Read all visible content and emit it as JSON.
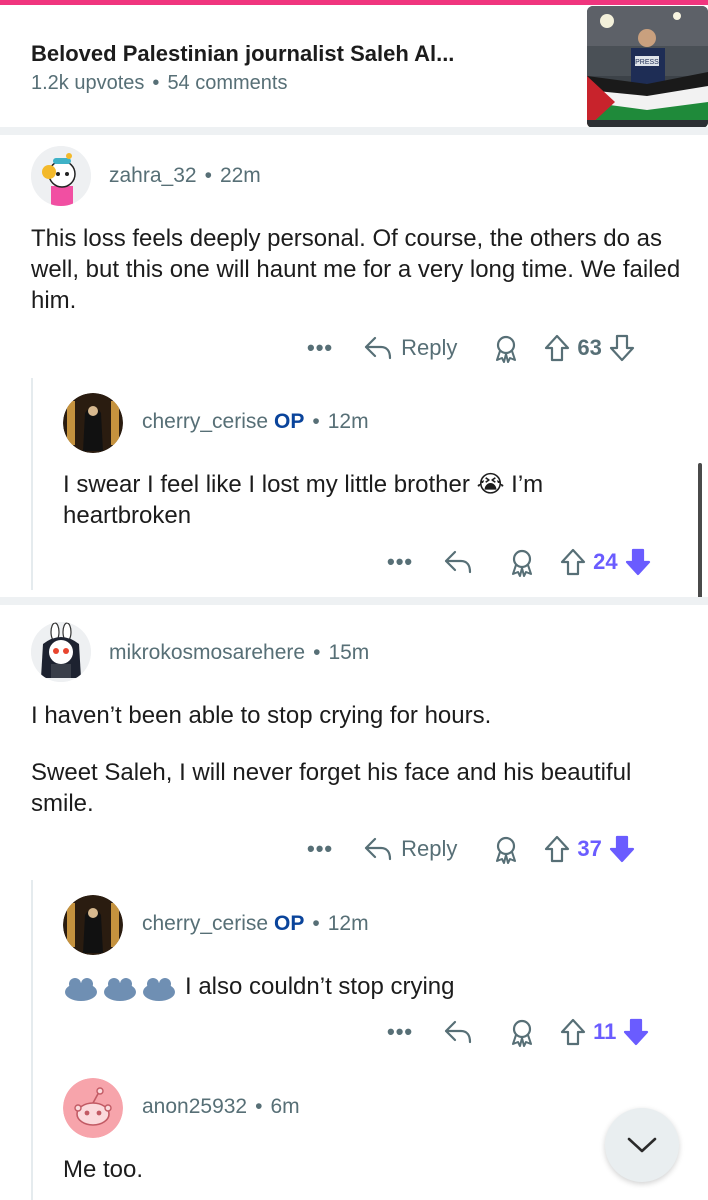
{
  "post": {
    "title": "Beloved Palestinian journalist Saleh Al...",
    "upvotes": "1.2k upvotes",
    "comments": "54 comments",
    "thumbnail_badge": "PRESS"
  },
  "separator": "•",
  "comments": [
    {
      "username": "zahra_32",
      "op": "",
      "time": "22m",
      "body": [
        "This loss feels deeply personal. Of course, the others do as well, but this one will haunt me for a very long time. We failed him."
      ],
      "reply_label": "Reply",
      "votes": "63",
      "downvoted": false
    },
    {
      "username": "cherry_cerise",
      "op": "OP",
      "time": "12m",
      "body": [
        "I swear I feel like I lost my little brother 😭 I’m heartbroken"
      ],
      "reply_label": "",
      "votes": "24",
      "downvoted": true
    },
    {
      "username": "mikrokosmosarehere",
      "op": "",
      "time": "15m",
      "body": [
        "I haven’t been able to stop crying for hours.",
        "Sweet Saleh, I will never forget his face and his beautiful smile."
      ],
      "reply_label": "Reply",
      "votes": "37",
      "downvoted": true
    },
    {
      "username": "cherry_cerise",
      "op": "OP",
      "time": "12m",
      "body": [
        "I also couldn’t stop crying"
      ],
      "reply_label": "",
      "votes": "11",
      "downvoted": true
    },
    {
      "username": "anon25932",
      "op": "",
      "time": "6m",
      "body": [
        "Me too."
      ],
      "reply_label": "",
      "votes": "",
      "downvoted": false
    }
  ],
  "ellipsis": "•••",
  "icons": {
    "reply": "reply-arrow-icon",
    "award": "award-icon",
    "upvote": "upvote-icon",
    "downvote": "downvote-icon",
    "scroll_down": "chevron-down-icon"
  },
  "colors": {
    "accent_top": "#f0357e",
    "op_label": "#0a449b",
    "downvote_active": "#6a5cff",
    "meta_text": "#576f76"
  }
}
